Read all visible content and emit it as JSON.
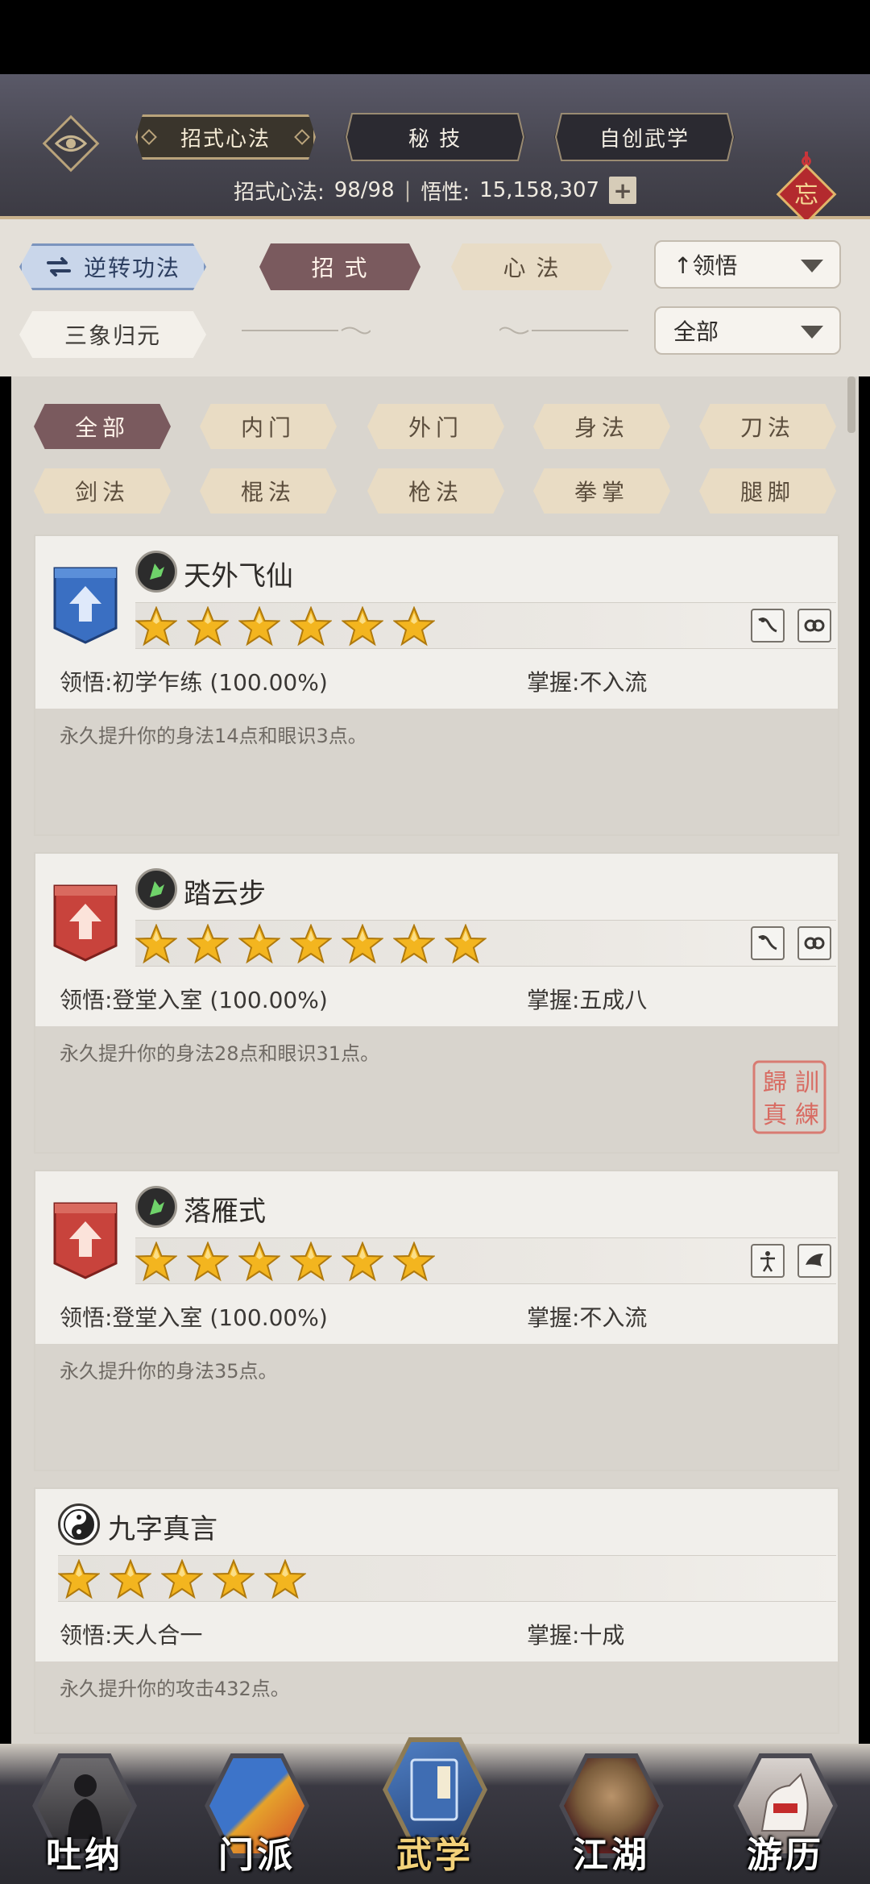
{
  "header": {
    "tabs": [
      "招式心法",
      "秘 技",
      "自创武学"
    ],
    "stats_label": "招式心法:",
    "stats_value": "98/98",
    "comprehension_label": "悟性:",
    "comprehension_value": "15,158,307",
    "plus": "+",
    "knot_char": "忘"
  },
  "filters": {
    "reverse_button": "逆转功法",
    "tab_moves": "招 式",
    "tab_mind": "心 法",
    "sort_dropdown": "↑领悟",
    "merge_button": "三象归元",
    "category_dropdown": "全部"
  },
  "categories": [
    "全部",
    "内门",
    "外门",
    "身法",
    "刀法",
    "剑法",
    "棍法",
    "枪法",
    "拳掌",
    "腿脚"
  ],
  "skills": [
    {
      "name": "天外飞仙",
      "stars": 6,
      "badge": "blue",
      "comprehension": "领悟:初学乍练 (100.00%)",
      "mastery": "掌握:不入流",
      "description": "永久提升你的身法14点和眼识3点。"
    },
    {
      "name": "踏云步",
      "stars": 7,
      "badge": "red",
      "comprehension": "领悟:登堂入室 (100.00%)",
      "mastery": "掌握:五成八",
      "description": "永久提升你的身法28点和眼识31点。",
      "seal": "訓練歸真"
    },
    {
      "name": "落雁式",
      "stars": 6,
      "badge": "red",
      "comprehension": "领悟:登堂入室 (100.00%)",
      "mastery": "掌握:不入流",
      "description": "永久提升你的身法35点。"
    },
    {
      "name": "九字真言",
      "stars": 5,
      "badge": "none",
      "comprehension": "领悟:天人合一",
      "mastery": "掌握:十成",
      "description": "永久提升你的攻击432点。"
    }
  ],
  "nav": [
    {
      "label": "吐纳",
      "active": false
    },
    {
      "label": "门派",
      "active": false
    },
    {
      "label": "武学",
      "active": true
    },
    {
      "label": "江湖",
      "active": false
    },
    {
      "label": "游历",
      "active": false
    }
  ],
  "colors": {
    "header_bg": "#4a4953",
    "gold_trim": "#b9a37b",
    "maroon": "#7a5a5e",
    "star_gold": "#f3b51f",
    "badge_blue": "#3a6fc2",
    "badge_red": "#c8433c"
  }
}
